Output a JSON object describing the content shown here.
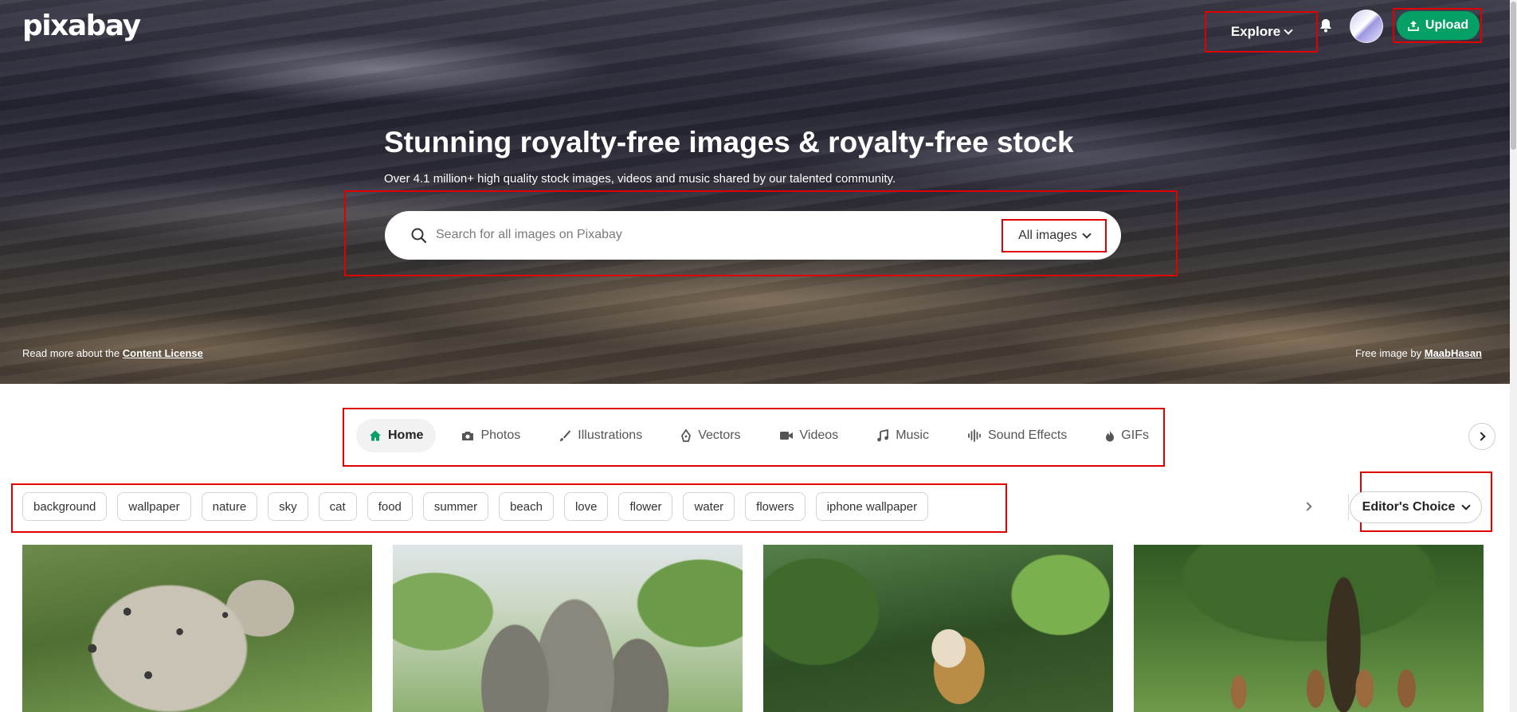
{
  "header": {
    "logo": "pixabay",
    "explore_label": "Explore",
    "upload_label": "Upload"
  },
  "hero": {
    "title": "Stunning royalty-free images & royalty-free stock",
    "subtitle": "Over 4.1 million+ high quality stock images, videos and music shared by our talented community.",
    "search_placeholder": "Search for all images on Pixabay",
    "search_type": "All images",
    "license_prefix": "Read more about the",
    "license_link": "Content License",
    "credit_prefix": "Free image by",
    "credit_author": "MaabHasan"
  },
  "tabs": [
    {
      "label": "Home",
      "icon": "home-icon",
      "active": true
    },
    {
      "label": "Photos",
      "icon": "camera-icon"
    },
    {
      "label": "Illustrations",
      "icon": "brush-icon"
    },
    {
      "label": "Vectors",
      "icon": "pen-nib-icon"
    },
    {
      "label": "Videos",
      "icon": "video-camera-icon"
    },
    {
      "label": "Music",
      "icon": "music-note-icon"
    },
    {
      "label": "Sound Effects",
      "icon": "waveform-icon"
    },
    {
      "label": "GIFs",
      "icon": "flame-icon"
    }
  ],
  "tags": [
    "background",
    "wallpaper",
    "nature",
    "sky",
    "cat",
    "food",
    "summer",
    "beach",
    "love",
    "flower",
    "water",
    "flowers",
    "iphone wallpaper"
  ],
  "filter": {
    "label": "Editor's Choice"
  },
  "colors": {
    "accent": "#04a066",
    "highlight": "#e00000"
  }
}
